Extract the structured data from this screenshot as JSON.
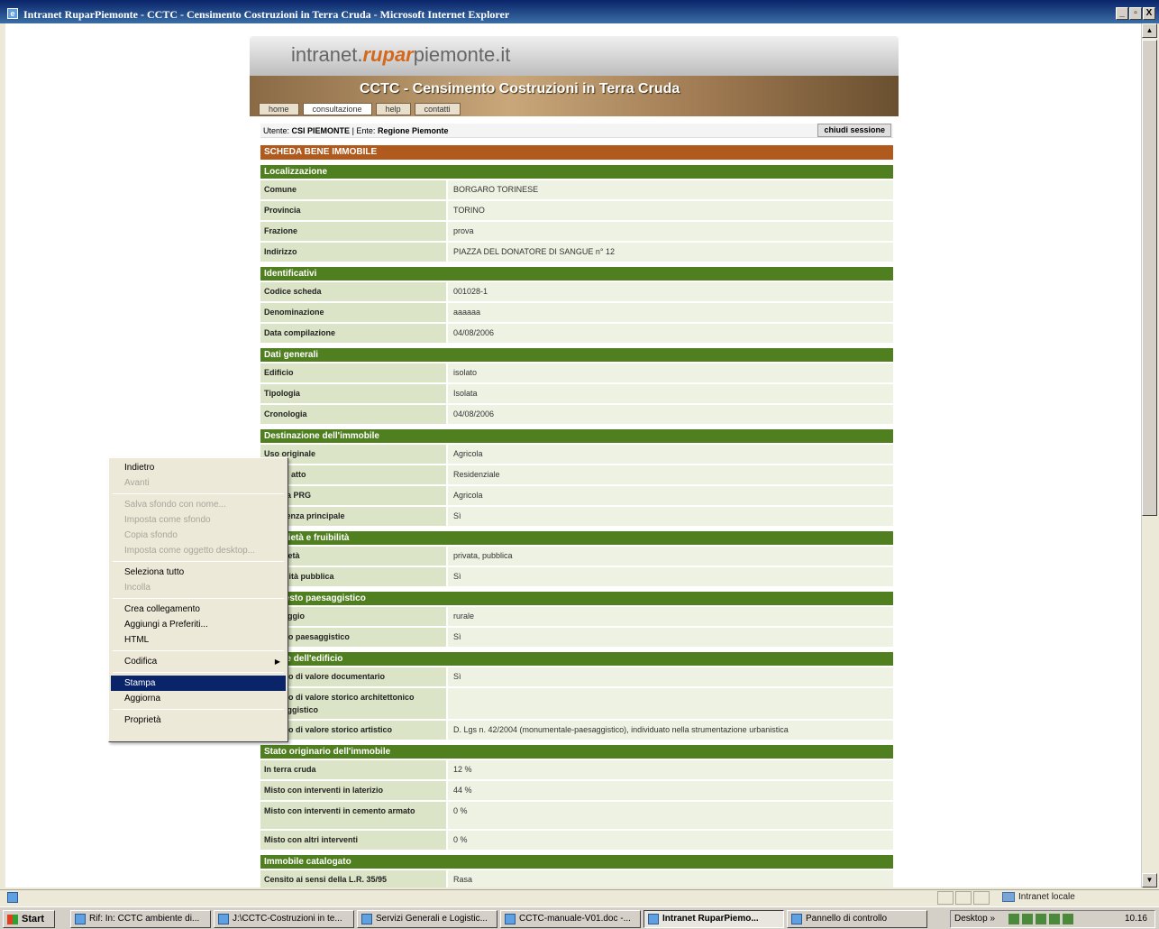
{
  "window": {
    "title": "Intranet RuparPiemonte - CCTC - Censimento Costruzioni in Terra Cruda - Microsoft Internet Explorer",
    "minimize": "_",
    "maximize": "▫",
    "close": "X"
  },
  "site": {
    "logo_prefix": "intranet.",
    "logo_brand": "rupar",
    "logo_suffix": "piemonte.it",
    "banner_title": "CCTC - Censimento Costruzioni in Terra Cruda",
    "tabs": [
      "home",
      "consultazione",
      "help",
      "contatti"
    ],
    "active_tab": "consultazione"
  },
  "userbar": {
    "utente_label": "Utente:",
    "utente_value": "CSI PIEMONTE",
    "ente_label": "| Ente:",
    "ente_value": "Regione Piemonte",
    "close_session": "chiudi sessione"
  },
  "card_title": "SCHEDA BENE IMMOBILE",
  "sections": [
    {
      "title": "Localizzazione",
      "rows": [
        {
          "k": "Comune",
          "v": "BORGARO TORINESE"
        },
        {
          "k": "Provincia",
          "v": "TORINO"
        },
        {
          "k": "Frazione",
          "v": "prova"
        },
        {
          "k": "Indirizzo",
          "v": "PIAZZA DEL DONATORE DI SANGUE n° 12"
        }
      ]
    },
    {
      "title": "Identificativi",
      "rows": [
        {
          "k": "Codice scheda",
          "v": "001028-1"
        },
        {
          "k": "Denominazione",
          "v": "aaaaaa"
        },
        {
          "k": "Data compilazione",
          "v": "04/08/2006"
        }
      ]
    },
    {
      "title": "Dati generali",
      "rows": [
        {
          "k": "Edificio",
          "v": "isolato"
        },
        {
          "k": "Tipologia",
          "v": "Isolata"
        },
        {
          "k": "Cronologia",
          "v": "04/08/2006"
        }
      ]
    },
    {
      "title": "Destinazione dell'immobile",
      "rows": [
        {
          "k": "Uso originale",
          "v": "Agricola"
        },
        {
          "k": "Uso in atto",
          "v": "Residenziale"
        },
        {
          "k": "Uso da PRG",
          "v": "Agricola"
        },
        {
          "k": "Residenza principale",
          "v": "Sì"
        }
      ]
    },
    {
      "title": "Proprietà e fruibilità",
      "rows": [
        {
          "k": "Proprietà",
          "v": "privata, pubblica"
        },
        {
          "k": "Fruibilità pubblica",
          "v": "Sì"
        }
      ]
    },
    {
      "title": "Contesto paesaggistico",
      "rows": [
        {
          "k": "Paesaggio",
          "v": "rurale"
        },
        {
          "k": "Vincolo paesaggistico",
          "v": "Sì"
        }
      ]
    },
    {
      "title": "Valore dell'edificio",
      "rows": [
        {
          "k": "Edificio di valore documentario",
          "v": "Sì"
        },
        {
          "k": "Edificio di valore storico architettonico paesaggistico",
          "v": "",
          "tall": true
        },
        {
          "k": "Edificio di valore storico artistico",
          "v": "D. Lgs n. 42/2004 (monumentale-paesaggistico), individuato nella strumentazione urbanistica"
        }
      ]
    },
    {
      "title": "Stato originario dell'immobile",
      "rows": [
        {
          "k": "In terra cruda",
          "v": "12 %"
        },
        {
          "k": "Misto con interventi in laterizio",
          "v": "44 %"
        },
        {
          "k": "Misto con interventi in cemento armato",
          "v": "0 %",
          "tall": true
        },
        {
          "k": "Misto con altri interventi",
          "v": "0 %"
        }
      ]
    },
    {
      "title": "Immobile catalogato",
      "rows": [
        {
          "k": "Censito ai sensi della L.R. 35/95",
          "v": "Rasa"
        }
      ]
    }
  ],
  "context_menu": [
    {
      "label": "Indietro",
      "disabled": false
    },
    {
      "label": "Avanti",
      "disabled": true
    },
    {
      "sep": true
    },
    {
      "label": "Salva sfondo con nome...",
      "disabled": true
    },
    {
      "label": "Imposta come sfondo",
      "disabled": true
    },
    {
      "label": "Copia sfondo",
      "disabled": true
    },
    {
      "label": "Imposta come oggetto desktop...",
      "disabled": true
    },
    {
      "sep": true
    },
    {
      "label": "Seleziona tutto",
      "disabled": false
    },
    {
      "label": "Incolla",
      "disabled": true
    },
    {
      "sep": true
    },
    {
      "label": "Crea collegamento",
      "disabled": false
    },
    {
      "label": "Aggiungi a Preferiti...",
      "disabled": false
    },
    {
      "label": "HTML",
      "disabled": false
    },
    {
      "sep": true
    },
    {
      "label": "Codifica",
      "disabled": false,
      "submenu": true
    },
    {
      "sep": true
    },
    {
      "label": "Stampa",
      "disabled": false,
      "selected": true
    },
    {
      "label": "Aggiorna",
      "disabled": false
    },
    {
      "sep": true
    },
    {
      "label": "Proprietà",
      "disabled": false
    }
  ],
  "statusbar": {
    "zone": "Intranet locale"
  },
  "taskbar": {
    "start": "Start",
    "tasks": [
      {
        "label": "Rif: In: CCTC ambiente di...",
        "active": false
      },
      {
        "label": "J:\\CCTC-Costruzioni in te...",
        "active": false
      },
      {
        "label": "Servizi Generali e Logistic...",
        "active": false
      },
      {
        "label": "CCTC-manuale-V01.doc -...",
        "active": false
      },
      {
        "label": "Intranet RuparPiemo...",
        "active": true
      },
      {
        "label": "Pannello di controllo",
        "active": false
      }
    ],
    "desktop": "Desktop",
    "desktop_chevron": "»",
    "clock": "10.16"
  }
}
